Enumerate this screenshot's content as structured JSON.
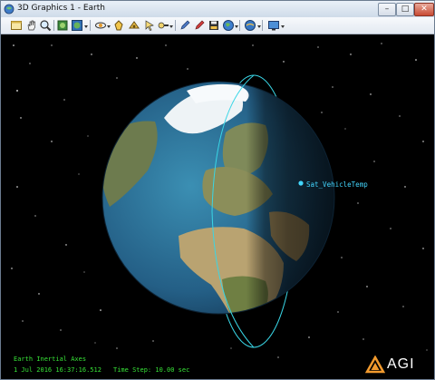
{
  "window": {
    "title": "3D Graphics 1 - Earth",
    "controls": {
      "minimize": "–",
      "maximize": "□",
      "close": "✕"
    }
  },
  "toolbar": {
    "icons": [
      "view-icon",
      "pan-hand-icon",
      "zoom-icon",
      "home-view-icon",
      "globe-view-icon",
      "spin-icon",
      "place-icon",
      "measure-icon",
      "pointer-icon",
      "pencil-icon",
      "marker-icon",
      "save-icon",
      "earth-icon",
      "satellite-icon",
      "tool-icon",
      "screen-icon",
      "settings-icon"
    ]
  },
  "scene": {
    "satellite_label": "Sat_VehicleTemp",
    "axes_label": "Earth Inertial Axes",
    "date_time": "1 Jul 2016 16:37:16.512",
    "time_step": "Time Step: 10.00 sec",
    "orbit_color": "#39d6e6",
    "overlay_text_color": "#37e337",
    "brand": "AGI"
  }
}
